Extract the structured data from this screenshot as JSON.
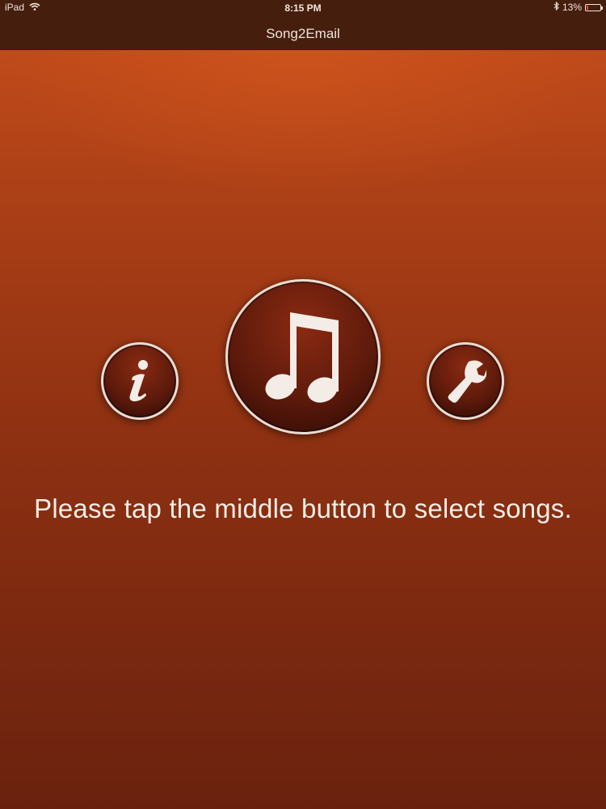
{
  "status_bar": {
    "device": "iPad",
    "time": "8:15 PM",
    "battery_text": "13%",
    "battery_level": 0.13,
    "icons": [
      "wifi-icon",
      "bluetooth-icon",
      "battery-icon"
    ]
  },
  "nav": {
    "title": "Song2Email"
  },
  "buttons": {
    "info": {
      "icon": "info-icon"
    },
    "music": {
      "icon": "music-note-icon"
    },
    "settings": {
      "icon": "wrench-icon"
    }
  },
  "instruction": "Please tap the middle button to select songs.",
  "colors": {
    "nav_bar": "#451e0e",
    "background_top": "#c04a1a",
    "background_bottom": "#6a220e",
    "button_face": "#5e1a0b",
    "button_ring": "#e8ddd5",
    "text": "#f3ece6"
  }
}
